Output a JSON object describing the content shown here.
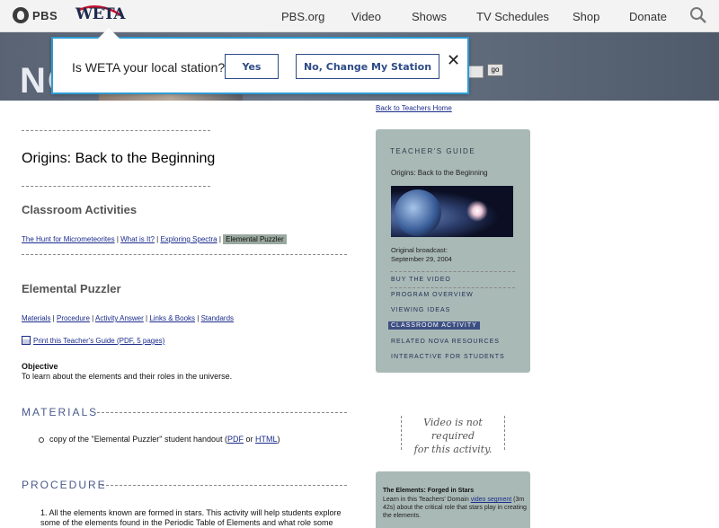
{
  "topbar": {
    "pbs_label": "PBS",
    "station_logo": "WETA",
    "nav": [
      "PBS.org",
      "Video",
      "Shows",
      "TV Schedules",
      "Shop",
      "Donate"
    ]
  },
  "banner": {
    "word": "NO",
    "go_label": "go"
  },
  "popup": {
    "question": "Is WETA your local station?",
    "yes": "Yes",
    "change": "No, Change My Station",
    "close": "✕"
  },
  "main": {
    "title": "Origins: Back to the Beginning",
    "section_title": "Classroom Activities",
    "activities": [
      "The Hunt for Micrometeorites",
      "What is It?",
      "Exploring Spectra",
      "Elemental Puzzler"
    ],
    "activity_title": "Elemental Puzzler",
    "subnav": [
      "Materials",
      "Procedure",
      "Activity Answer",
      "Links & Books",
      "Standards"
    ],
    "print_link": "Print this Teacher's Guide (PDF, 5 pages)",
    "objective_heading": "Objective",
    "objective_text": "To learn about the elements and their roles in the universe.",
    "materials_heading": "MATERIALS",
    "materials_item_pre": "copy of the \"Elemental Puzzler\" student handout (",
    "materials_pdf": "PDF",
    "materials_or": " or ",
    "materials_html": "HTML",
    "materials_item_post": ")",
    "procedure_heading": "PROCEDURE",
    "procedure_item": "1. All the elements known are formed in stars. This activity will help students explore some of the elements found in the Periodic Table of Elements and what role some"
  },
  "sidebar": {
    "back_link": "Back to Teachers Home",
    "guide_heading": "TEACHER'S GUIDE",
    "guide_subtitle": "Origins: Back to the Beginning",
    "broadcast_label": "Original broadcast:",
    "broadcast_date": "September 29, 2004",
    "menu": [
      "BUY THE VIDEO",
      "PROGRAM OVERVIEW",
      "VIEWING IDEAS",
      "CLASSROOM ACTIVITY",
      "RELATED NOVA RESOURCES",
      "INTERACTIVE FOR STUDENTS"
    ],
    "active_menu": "CLASSROOM ACTIVITY",
    "note_line1": "Video is not required",
    "note_line2": "for this activity.",
    "forged_heading": "The Elements: Forged in Stars",
    "forged_pre": "Learn in this Teachers' Domain ",
    "forged_link": "video segment",
    "forged_post": " (3m 42s) about the critical role that stars play in creating the elements."
  },
  "colors": {
    "popup_border": "#2e9bd6",
    "button_text": "#2d4b86",
    "guide_bg": "#a9b9b6",
    "active_menu_bg": "#3d4f82"
  },
  "icons": [
    "pbs-logo-icon",
    "search-icon",
    "close-icon",
    "print-icon"
  ]
}
